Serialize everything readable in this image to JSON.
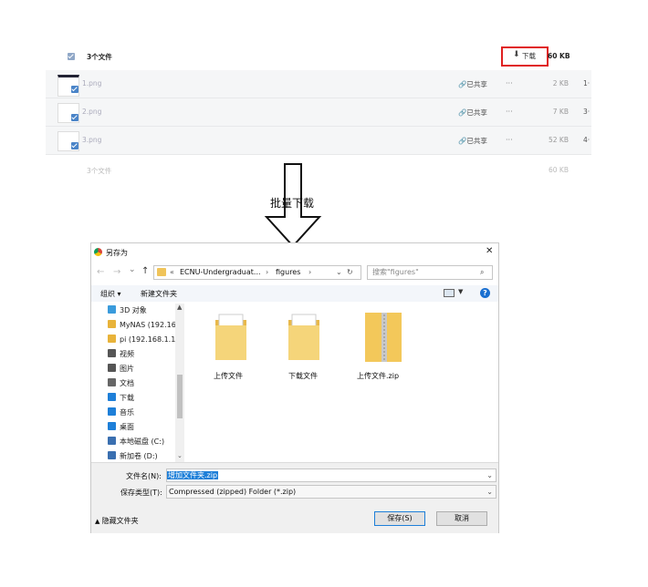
{
  "list": {
    "header": {
      "name": "3个文件",
      "download": "下载",
      "size": "60 KB"
    },
    "rows": [
      {
        "name": "1.png",
        "shared": "已共享",
        "more": "···",
        "size": "2 KB",
        "cut": "1·"
      },
      {
        "name": "2.png",
        "shared": "已共享",
        "more": "···",
        "size": "7 KB",
        "cut": "3·"
      },
      {
        "name": "3.png",
        "shared": "已共享",
        "more": "···",
        "size": "52 KB",
        "cut": "4·"
      }
    ],
    "footer": {
      "name": "3个文件",
      "size": "60 KB"
    }
  },
  "annotation": {
    "label": "批量下载"
  },
  "dialog": {
    "title": "另存为",
    "close": "✕",
    "nav": {
      "back": "←",
      "forward": "→",
      "recent": "⌄",
      "up": "↑"
    },
    "path": {
      "chevron": "«",
      "seg1": "ECNU-Undergraduat...",
      "sep1": "›",
      "seg2": "figures",
      "sep2": "›"
    },
    "search_placeholder": "搜索\"figures\"",
    "toolbar": {
      "organize": "组织 ▾",
      "new_folder": "新建文件夹"
    },
    "sidebar": [
      {
        "label": "3D 对象",
        "icon": "3d-objects-icon",
        "color": "#3a9bdc"
      },
      {
        "label": "MyNAS (192.16",
        "icon": "network-drive-icon",
        "color": "#e8b33a"
      },
      {
        "label": "pi (192.168.1.1(",
        "icon": "network-drive-icon",
        "color": "#e8b33a"
      },
      {
        "label": "视频",
        "icon": "video-icon",
        "color": "#555555"
      },
      {
        "label": "图片",
        "icon": "pictures-icon",
        "color": "#555555"
      },
      {
        "label": "文档",
        "icon": "documents-icon",
        "color": "#666666"
      },
      {
        "label": "下载",
        "icon": "download-icon",
        "color": "#1e7fd8"
      },
      {
        "label": "音乐",
        "icon": "music-icon",
        "color": "#1e7fd8"
      },
      {
        "label": "桌面",
        "icon": "desktop-icon",
        "color": "#1e7fd8"
      },
      {
        "label": "本地磁盘 (C:)",
        "icon": "local-disk-icon",
        "color": "#3a6fb0"
      },
      {
        "label": "新加卷 (D:)",
        "icon": "local-disk-icon",
        "color": "#3a6fb0"
      }
    ],
    "files": [
      {
        "label": "上传文件",
        "type": "folder"
      },
      {
        "label": "下载文件",
        "type": "folder"
      },
      {
        "label": "上传文件.zip",
        "type": "zip"
      }
    ],
    "filename_label": "文件名(N):",
    "filename_value": "增加文件夹.zip",
    "type_label": "保存类型(T):",
    "type_value": "Compressed (zipped) Folder (*.zip)",
    "hide_folders": "隐藏文件夹",
    "save": "保存(S)",
    "cancel": "取消"
  },
  "colors": {
    "highlight_box": "#e02020",
    "accent": "#1e7fd8",
    "help": "#1a6fd0"
  }
}
